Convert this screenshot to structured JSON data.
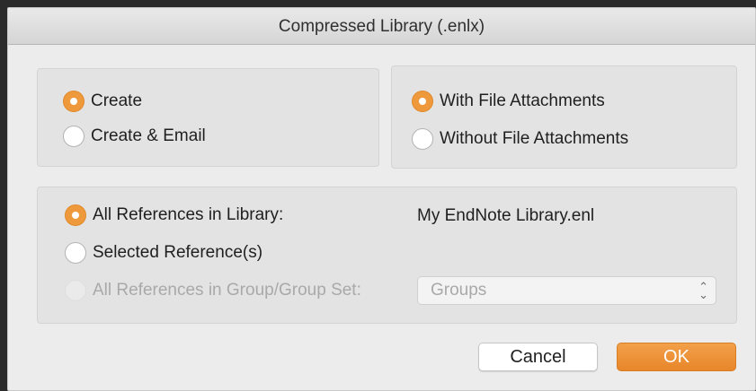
{
  "dialog": {
    "title": "Compressed Library (.enlx)"
  },
  "action_group": {
    "options": [
      {
        "label": "Create",
        "selected": true
      },
      {
        "label": "Create & Email",
        "selected": false
      }
    ]
  },
  "attachments_group": {
    "options": [
      {
        "label": "With File Attachments",
        "selected": true
      },
      {
        "label": "Without File Attachments",
        "selected": false
      }
    ]
  },
  "references_group": {
    "all_label": "All References in Library:",
    "library_name": "My EndNote Library.enl",
    "selected_label": "Selected Reference(s)",
    "group_label": "All References in Group/Group Set:",
    "group_select_value": "Groups"
  },
  "buttons": {
    "cancel": "Cancel",
    "ok": "OK"
  },
  "colors": {
    "accent": "#ee9a3c",
    "dialog_bg": "#ececec",
    "panel_bg": "#e3e3e3"
  },
  "icons": {
    "select_chevron": "chevron-up-down-icon"
  }
}
